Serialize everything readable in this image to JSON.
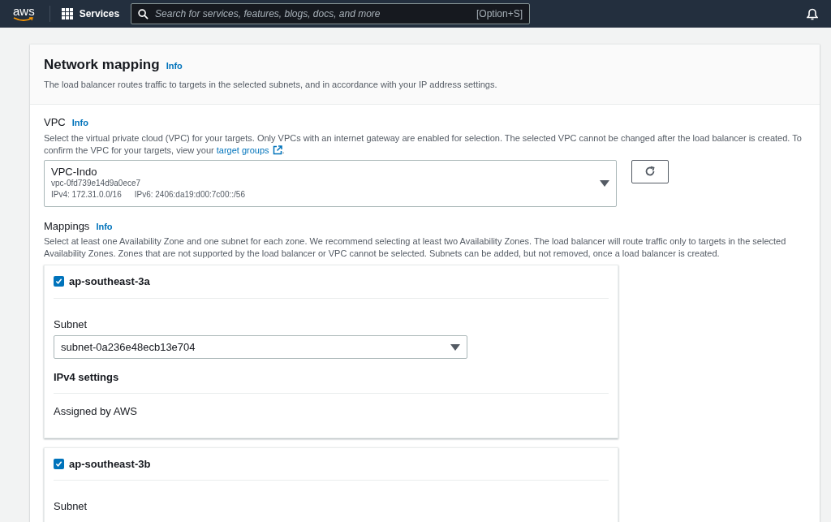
{
  "top_nav": {
    "logo": "aws",
    "services_label": "Services",
    "search": {
      "placeholder": "Search for services, features, blogs, docs, and more"
    },
    "shortcut": "[Option+S]"
  },
  "section": {
    "title": "Network mapping",
    "info": "Info",
    "description": "The load balancer routes traffic to targets in the selected subnets, and in accordance with your IP address settings."
  },
  "vpc": {
    "label": "VPC",
    "info": "Info",
    "description": "Select the virtual private cloud (VPC) for your targets. Only VPCs with an internet gateway are enabled for selection. The selected VPC cannot be changed after the load balancer is created. To confirm the VPC for your targets, view your ",
    "link": "target groups",
    "description_end": ".",
    "select": {
      "name": "VPC-Indo",
      "id": "vpc-0fd739e14d9a0ece7",
      "ipv4": "IPv4: 172.31.0.0/16",
      "ipv6": "IPv6: 2406:da19:d00:7c00::/56"
    }
  },
  "mappings": {
    "label": "Mappings",
    "info": "Info",
    "description": "Select at least one Availability Zone and one subnet for each zone. We recommend selecting at least two Availability Zones. The load balancer will route traffic only to targets in the selected Availability Zones. Zones that are not supported by the load balancer or VPC cannot be selected. Subnets can be added, but not removed, once a load balancer is created.",
    "zones": [
      {
        "name": "ap-southeast-3a",
        "checked": true,
        "subnet_label": "Subnet",
        "subnet": "subnet-0a236e48ecb13e704",
        "ipv4_title": "IPv4 settings",
        "ipv4_value": "Assigned by AWS"
      },
      {
        "name": "ap-southeast-3b",
        "checked": true,
        "subnet_label": "Subnet"
      }
    ]
  }
}
